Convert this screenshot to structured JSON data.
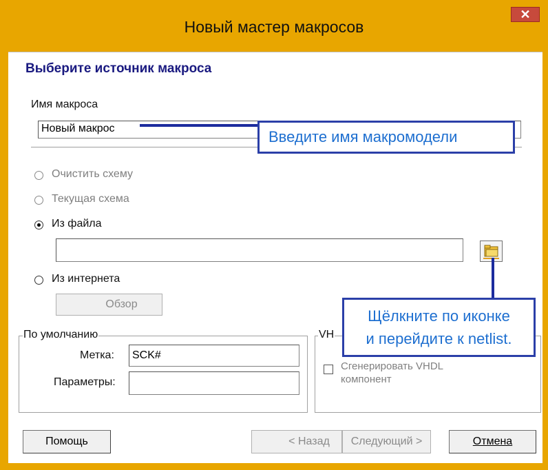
{
  "window": {
    "title": "Новый мастер макросов",
    "close_symbol": "✕"
  },
  "page": {
    "heading": "Выберите источник макроса"
  },
  "macro_name": {
    "label": "Имя макроса",
    "value": "Новый макрос"
  },
  "source": {
    "options": [
      {
        "label": "Очистить схему",
        "selected": false,
        "enabled": false
      },
      {
        "label": "Текущая схема",
        "selected": false,
        "enabled": false
      },
      {
        "label": "Из файла",
        "selected": true,
        "enabled": true
      },
      {
        "label": "Из интернета",
        "selected": false,
        "enabled": true
      }
    ],
    "file_path": "",
    "browse_label": "Обзор"
  },
  "defaults": {
    "title": "По умолчанию",
    "label_caption": "Метка:",
    "label_value": "SCK#",
    "params_caption": "Параметры:",
    "params_value": ""
  },
  "vhdl": {
    "title": "VH",
    "checkbox_label_line1": "Сгенерировать VHDL",
    "checkbox_label_line2": "компонент"
  },
  "callouts": {
    "name_hint": "Введите имя макромодели",
    "icon_hint_line1": "Щёлкните по иконке",
    "icon_hint_line2": "и перейдите к netlist."
  },
  "footer": {
    "help": "Помощь",
    "back": "< Назад",
    "next": "Следующий >",
    "cancel": "Отмена"
  },
  "colors": {
    "frame": "#e8a600",
    "callout_border": "#2b3fa8",
    "callout_text": "#1e6fd0",
    "heading": "#1a1a80"
  }
}
